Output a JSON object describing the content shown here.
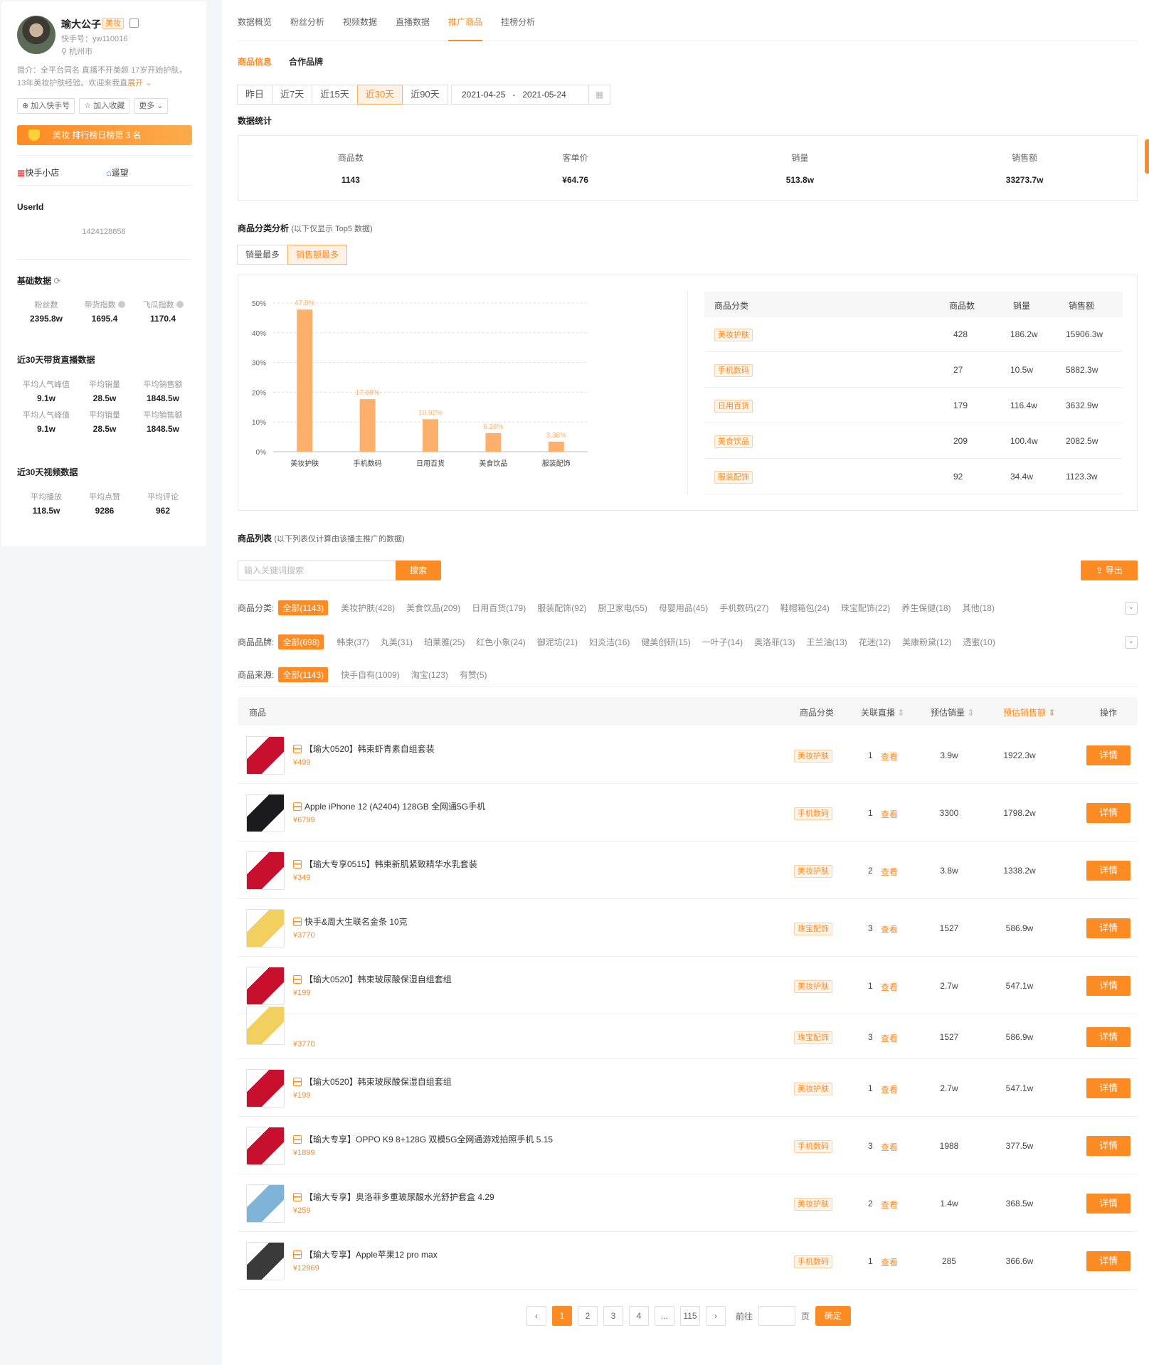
{
  "profile": {
    "name": "瑜大公子",
    "tag": "美妆",
    "kuaishou_id": "快手号：yw110016",
    "city": "杭州市",
    "bio": "简介：全平台同名 直播不开美颜 17岁开始护肤，13年美妆护肤经验。欢迎来我直",
    "bio_more": "展开",
    "btn_follow": "加入快手号",
    "btn_collect": "加入收藏",
    "btn_more": "更多",
    "rank": "美妆 排行榜日榜第 3 名",
    "shop": "快手小店",
    "guild": "遥望",
    "userid_label": "UserId",
    "userid": "1424128656"
  },
  "basic": {
    "title": "基础数据",
    "stats": [
      {
        "k": "粉丝数",
        "v": "2395.8w"
      },
      {
        "k": "带货指数",
        "v": "1695.4"
      },
      {
        "k": "飞瓜指数",
        "v": "1170.4"
      }
    ]
  },
  "live30": {
    "title": "近30天带货直播数据",
    "row1": [
      {
        "k": "平均人气峰值",
        "v": "9.1w"
      },
      {
        "k": "平均销量",
        "v": "28.5w"
      },
      {
        "k": "平均销售额",
        "v": "1848.5w"
      }
    ],
    "row2": [
      {
        "k": "平均人气峰值",
        "v": "9.1w"
      },
      {
        "k": "平均销量",
        "v": "28.5w"
      },
      {
        "k": "平均销售额",
        "v": "1848.5w"
      }
    ]
  },
  "video30": {
    "title": "近30天视频数据",
    "stats": [
      {
        "k": "平均播放",
        "v": "118.5w"
      },
      {
        "k": "平均点赞",
        "v": "9286"
      },
      {
        "k": "平均评论",
        "v": "962"
      }
    ]
  },
  "tabs": [
    "数据概览",
    "粉丝分析",
    "视频数据",
    "直播数据",
    "推广商品",
    "挂榜分析"
  ],
  "subtabs": [
    "商品信息",
    "合作品牌"
  ],
  "date_buttons": [
    "昨日",
    "近7天",
    "近15天",
    "近30天",
    "近90天"
  ],
  "date_range": "2021-04-25   -   2021-05-24",
  "stats_title": "数据统计",
  "stats": [
    {
      "k": "商品数",
      "v": "1143"
    },
    {
      "k": "客单价",
      "v": "¥64.76"
    },
    {
      "k": "销量",
      "v": "513.8w"
    },
    {
      "k": "销售额",
      "v": "33273.7w"
    }
  ],
  "cat_title": "商品分类分析",
  "cat_note": "(以下仅显示 Top5 数据)",
  "sort_buttons": [
    "销量最多",
    "销售额最多"
  ],
  "chart_data": {
    "type": "bar",
    "categories": [
      "美妆护肤",
      "手机数码",
      "日用百货",
      "美食饮品",
      "服装配饰"
    ],
    "values": [
      47.8,
      17.68,
      10.92,
      6.26,
      3.38
    ],
    "data_labels": [
      "47.8%",
      "17.68%",
      "10.92%",
      "6.26%",
      "3.38%"
    ],
    "yticks": [
      "0%",
      "10%",
      "20%",
      "30%",
      "40%",
      "50%"
    ],
    "ylim": [
      0,
      50
    ],
    "grid": true,
    "color": "#fdb06b"
  },
  "cat_table": {
    "headers": [
      "商品分类",
      "商品数",
      "销量",
      "销售额"
    ],
    "rows": [
      [
        "美妆护肤",
        "428",
        "186.2w",
        "15906.3w"
      ],
      [
        "手机数码",
        "27",
        "10.5w",
        "5882.3w"
      ],
      [
        "日用百货",
        "179",
        "116.4w",
        "3632.9w"
      ],
      [
        "美食饮品",
        "209",
        "100.4w",
        "2082.5w"
      ],
      [
        "服装配饰",
        "92",
        "34.4w",
        "1123.3w"
      ]
    ]
  },
  "list_title": "商品列表",
  "list_note": "(以下列表仅计算由该播主推广的数据)",
  "search_placeholder": "输入关键词搜索",
  "search_btn": "搜索",
  "export_btn": "导出",
  "filters": {
    "category": {
      "label": "商品分类:",
      "selected": "全部(1143)",
      "options": [
        "美妆护肤(428)",
        "美食饮品(209)",
        "日用百货(179)",
        "服装配饰(92)",
        "厨卫家电(55)",
        "母婴用品(45)",
        "手机数码(27)",
        "鞋帽箱包(24)",
        "珠宝配饰(22)",
        "养生保健(18)",
        "其他(18)"
      ]
    },
    "brand": {
      "label": "商品品牌:",
      "selected": "全部(698)",
      "options": [
        "韩束(37)",
        "丸美(31)",
        "珀莱雅(25)",
        "红色小象(24)",
        "御泥坊(21)",
        "妇炎洁(16)",
        "健美创研(15)",
        "一叶子(14)",
        "奥洛菲(13)",
        "王兰油(13)",
        "花迷(12)",
        "美康粉黛(12)",
        "透蜜(10)"
      ]
    },
    "source": {
      "label": "商品来源:",
      "selected": "全部(1143)",
      "options": [
        "快手自有(1009)",
        "淘宝(123)",
        "有赞(5)"
      ]
    }
  },
  "table_headers": {
    "product": "商品",
    "category": "商品分类",
    "live": "关联直播",
    "sales": "预估销量",
    "revenue": "预估销售额",
    "op": "操作"
  },
  "view_label": "查看",
  "detail_label": "详情",
  "products": [
    {
      "name": "【瑜大0520】韩束虾青素自组套装",
      "price": "¥499",
      "cat": "美妆护肤",
      "live": "1",
      "sales": "3.9w",
      "rev": "1922.3w"
    },
    {
      "name": "Apple iPhone 12 (A2404) 128GB 全网通5G手机",
      "price": "¥6799",
      "cat": "手机数码",
      "live": "1",
      "sales": "3300",
      "rev": "1798.2w"
    },
    {
      "name": "【瑜大专享0515】韩束新肌紧致精华水乳套装",
      "price": "¥349",
      "cat": "美妆护肤",
      "live": "2",
      "sales": "3.8w",
      "rev": "1338.2w"
    },
    {
      "name": "快手&周大生联名金条 10克",
      "price": "¥3770",
      "cat": "珠宝配饰",
      "live": "3",
      "sales": "1527",
      "rev": "586.9w"
    },
    {
      "name": "【瑜大0520】韩束玻尿酸保湿自组套组",
      "price": "¥199",
      "cat": "美妆护肤",
      "live": "1",
      "sales": "2.7w",
      "rev": "547.1w"
    },
    {
      "name": "",
      "price": "¥3770",
      "cat": "珠宝配饰",
      "live": "3",
      "sales": "1527",
      "rev": "586.9w"
    },
    {
      "name": "【瑜大0520】韩束玻尿酸保湿自组套组",
      "price": "¥199",
      "cat": "美妆护肤",
      "live": "1",
      "sales": "2.7w",
      "rev": "547.1w"
    },
    {
      "name": "【瑜大专享】OPPO K9 8+128G 双模5G全网通游戏拍照手机 5.15",
      "price": "¥1899",
      "cat": "手机数码",
      "live": "3",
      "sales": "1988",
      "rev": "377.5w"
    },
    {
      "name": "【瑜大专享】奥洛菲多重玻尿酸水光舒护套盒 4.29",
      "price": "¥259",
      "cat": "美妆护肤",
      "live": "2",
      "sales": "1.4w",
      "rev": "368.5w"
    },
    {
      "name": "【瑜大专享】Apple苹果12 pro max",
      "price": "¥12869",
      "cat": "手机数码",
      "live": "1",
      "sales": "285",
      "rev": "366.6w"
    }
  ],
  "pager": {
    "pages": [
      "1",
      "2",
      "3",
      "4",
      "...",
      "115"
    ],
    "goto": "前往",
    "page_unit": "页",
    "ok": "确定"
  }
}
